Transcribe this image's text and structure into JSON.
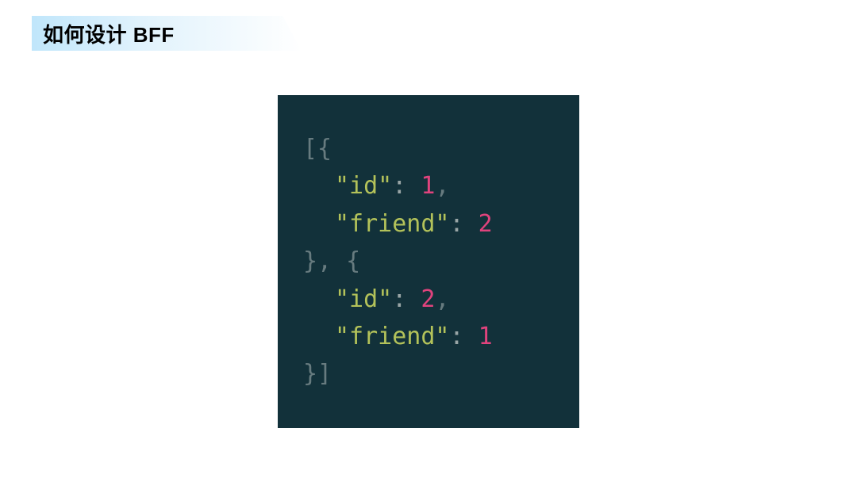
{
  "title": "如何设计 BFF",
  "code": {
    "lines": [
      {
        "indent": 0,
        "tokens": [
          {
            "cls": "tok-punc",
            "t": "[{"
          }
        ]
      },
      {
        "indent": 1,
        "tokens": [
          {
            "cls": "tok-string",
            "t": "\"id\""
          },
          {
            "cls": "tok-colon",
            "t": ": "
          },
          {
            "cls": "tok-number",
            "t": "1"
          },
          {
            "cls": "tok-punc",
            "t": ","
          }
        ]
      },
      {
        "indent": 1,
        "tokens": [
          {
            "cls": "tok-string",
            "t": "\"friend\""
          },
          {
            "cls": "tok-colon",
            "t": ": "
          },
          {
            "cls": "tok-number",
            "t": "2"
          }
        ]
      },
      {
        "indent": 0,
        "tokens": [
          {
            "cls": "tok-punc",
            "t": "}, {"
          }
        ]
      },
      {
        "indent": 1,
        "tokens": [
          {
            "cls": "tok-string",
            "t": "\"id\""
          },
          {
            "cls": "tok-colon",
            "t": ": "
          },
          {
            "cls": "tok-number",
            "t": "2"
          },
          {
            "cls": "tok-punc",
            "t": ","
          }
        ]
      },
      {
        "indent": 1,
        "tokens": [
          {
            "cls": "tok-string",
            "t": "\"friend\""
          },
          {
            "cls": "tok-colon",
            "t": ": "
          },
          {
            "cls": "tok-number",
            "t": "1"
          }
        ]
      },
      {
        "indent": 0,
        "tokens": [
          {
            "cls": "tok-punc",
            "t": "}]"
          }
        ]
      }
    ]
  }
}
